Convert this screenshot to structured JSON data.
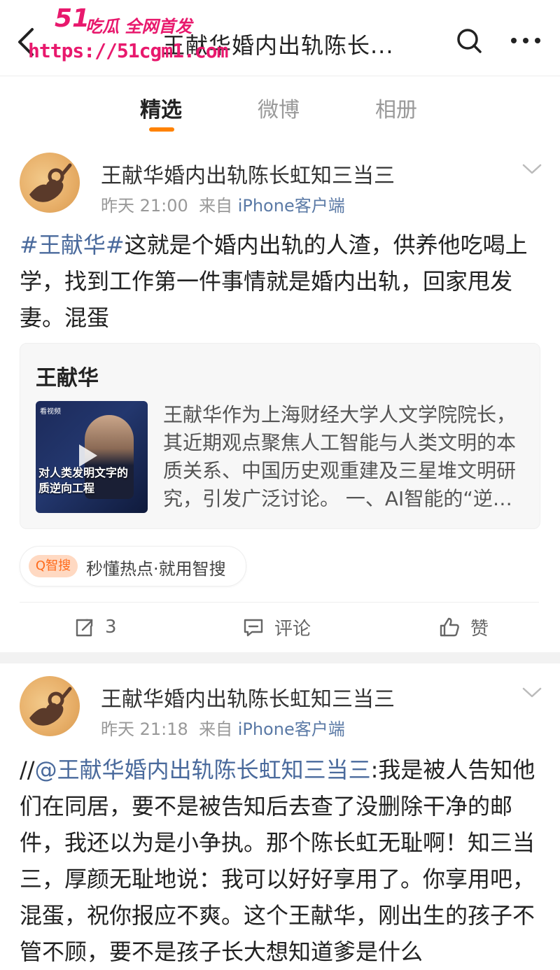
{
  "header": {
    "title": "王献华婚内出轨陈长...",
    "watermark_brand": "51",
    "watermark_slogan": "吃瓜 全网首发",
    "watermark_url": "https://51cgm1.com"
  },
  "tabs": [
    {
      "label": "精选",
      "active": true
    },
    {
      "label": "微博",
      "active": false
    },
    {
      "label": "相册",
      "active": false
    }
  ],
  "posts": [
    {
      "author": "王献华婚内出轨陈长虹知三当三",
      "time": "昨天 21:00",
      "from": "来自",
      "source": "iPhone客户端",
      "hashtag": "#王献华#",
      "text": "这就是个婚内出轨的人渣，供养他吃喝上学，找到工作第一件事情就是婚内出轨，回家甩发妻。混蛋",
      "card": {
        "title": "王献华",
        "thumb_logo": "看视频",
        "thumb_caption_1": "对人类发明文字的",
        "thumb_caption_2": "质逆向工程",
        "desc": "王献华作为上海财经大学人文学院院长，其近期观点聚焦人工智能与人类文明的本质关系、中国历史观重建及三星堆文明研究，引发广泛讨论。 一、AI智能的“逆…"
      },
      "smart_badge": "Q智搜",
      "smart_text": "秒懂热点·就用智搜",
      "actions": {
        "repost_count": "3",
        "comment_label": "评论",
        "like_label": "赞"
      }
    },
    {
      "author": "王献华婚内出轨陈长虹知三当三",
      "time": "昨天 21:18",
      "from": "来自",
      "source": "iPhone客户端",
      "prefix": "//",
      "mention": "@王献华婚内出轨陈长虹知三当三",
      "text": ":我是被人告知他们在同居，要不是被告知后去查了没删除干净的邮件，我还以为是小争执。那个陈长虹无耻啊！知三当三，厚颜无耻地说：我可以好好享用了。你享用吧，混蛋，祝你报应不爽。这个王献华，刚出生的孩子不管不顾，要不是孩子长大想知道爹是什么"
    }
  ],
  "colors": {
    "accent": "#ff8200",
    "link": "#4a6a9c",
    "watermark": "#e8196d"
  },
  "icons": [
    "back-arrow-icon",
    "search-icon",
    "more-icon",
    "chevron-down-icon",
    "repost-icon",
    "comment-icon",
    "like-icon",
    "play-icon"
  ]
}
